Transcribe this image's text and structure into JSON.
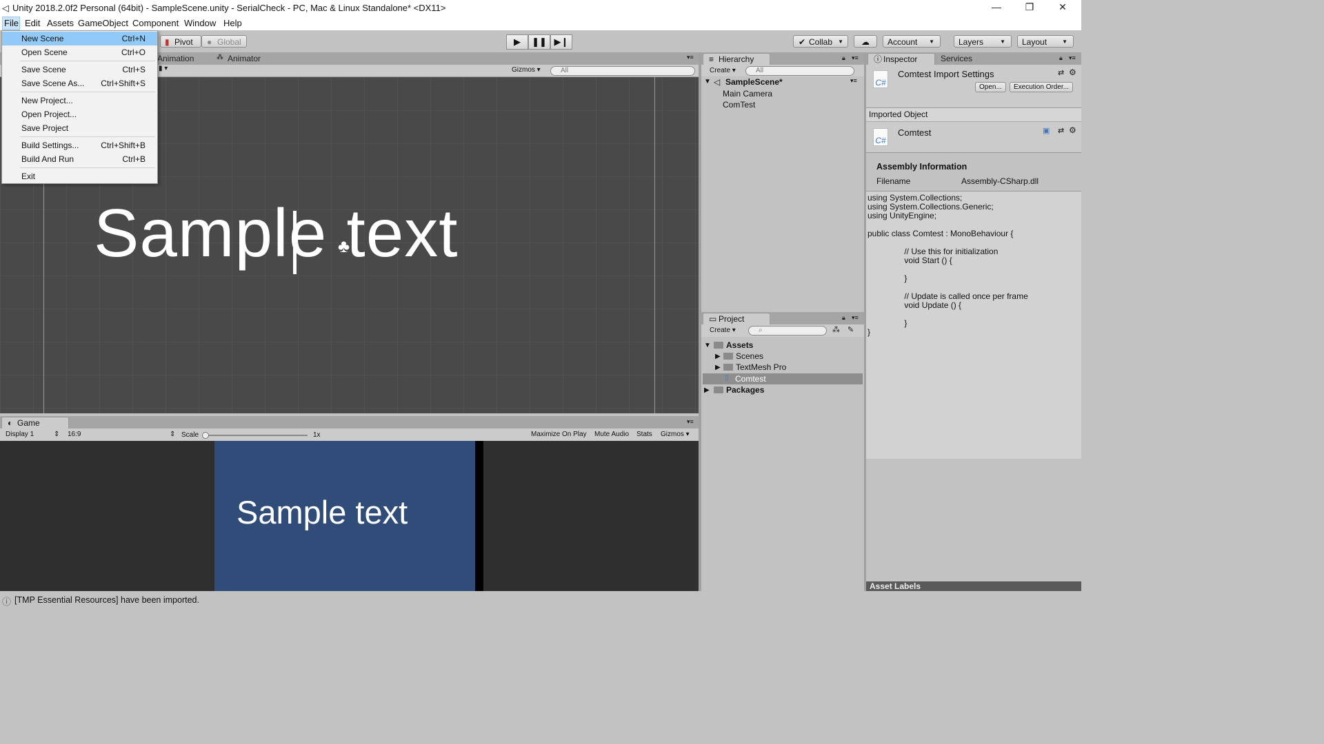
{
  "window": {
    "title": "Unity 2018.2.0f2 Personal (64bit) - SampleScene.unity - SerialCheck - PC, Mac & Linux Standalone* <DX11>",
    "controls": {
      "minimize": "—",
      "restore": "❐",
      "close": "✕"
    }
  },
  "menubar": [
    "File",
    "Edit",
    "Assets",
    "GameObject",
    "Component",
    "Window",
    "Help"
  ],
  "file_menu": {
    "items": [
      {
        "label": "New Scene",
        "shortcut": "Ctrl+N"
      },
      {
        "label": "Open Scene",
        "shortcut": "Ctrl+O"
      },
      {
        "label": "Save Scene",
        "shortcut": "Ctrl+S"
      },
      {
        "label": "Save Scene As...",
        "shortcut": "Ctrl+Shift+S"
      },
      {
        "label": "New Project...",
        "shortcut": ""
      },
      {
        "label": "Open Project...",
        "shortcut": ""
      },
      {
        "label": "Save Project",
        "shortcut": ""
      },
      {
        "label": "Build Settings...",
        "shortcut": "Ctrl+Shift+B"
      },
      {
        "label": "Build And Run",
        "shortcut": "Ctrl+B"
      },
      {
        "label": "Exit",
        "shortcut": ""
      }
    ]
  },
  "toolbar": {
    "pivot": "Pivot",
    "global": "Global",
    "collab": "Collab",
    "account": "Account",
    "layers": "Layers",
    "layout": "Layout"
  },
  "scene_panel": {
    "tabs": [
      "Animation",
      "Animator"
    ],
    "gizmos": "Gizmos",
    "search_placeholder": "All",
    "sample_text": "Sample text"
  },
  "game_panel": {
    "tab": "Game",
    "display": "Display 1",
    "aspect": "16:9",
    "scale_label": "Scale",
    "scale_value": "1x",
    "maximize": "Maximize On Play",
    "mute": "Mute Audio",
    "stats": "Stats",
    "gizmos": "Gizmos",
    "sample_text": "Sample text"
  },
  "hierarchy": {
    "tab": "Hierarchy",
    "create": "Create",
    "search_placeholder": "All",
    "scene": "SampleScene*",
    "items": [
      "Main Camera",
      "ComTest"
    ]
  },
  "project": {
    "tab": "Project",
    "create": "Create",
    "tree": {
      "assets": "Assets",
      "children": [
        "Scenes",
        "TextMesh Pro",
        "Comtest"
      ],
      "packages": "Packages"
    }
  },
  "inspector": {
    "tabs": [
      "Inspector",
      "Services"
    ],
    "title": "Comtest Import Settings",
    "open_btn": "Open...",
    "exec_btn": "Execution Order...",
    "imported_object": "Imported Object",
    "object_name": "Comtest",
    "cs_label": "C#",
    "assembly_header": "Assembly Information",
    "filename_label": "Filename",
    "filename_value": "Assembly-CSharp.dll",
    "code": "using System.Collections;\nusing System.Collections.Generic;\nusing UnityEngine;\n\npublic class Comtest : MonoBehaviour {\n\n                // Use this for initialization\n                void Start () {\n\n                }\n\n                // Update is called once per frame\n                void Update () {\n\n                }\n}",
    "asset_labels": "Asset Labels"
  },
  "status": {
    "message": "[TMP Essential Resources] have been imported."
  }
}
